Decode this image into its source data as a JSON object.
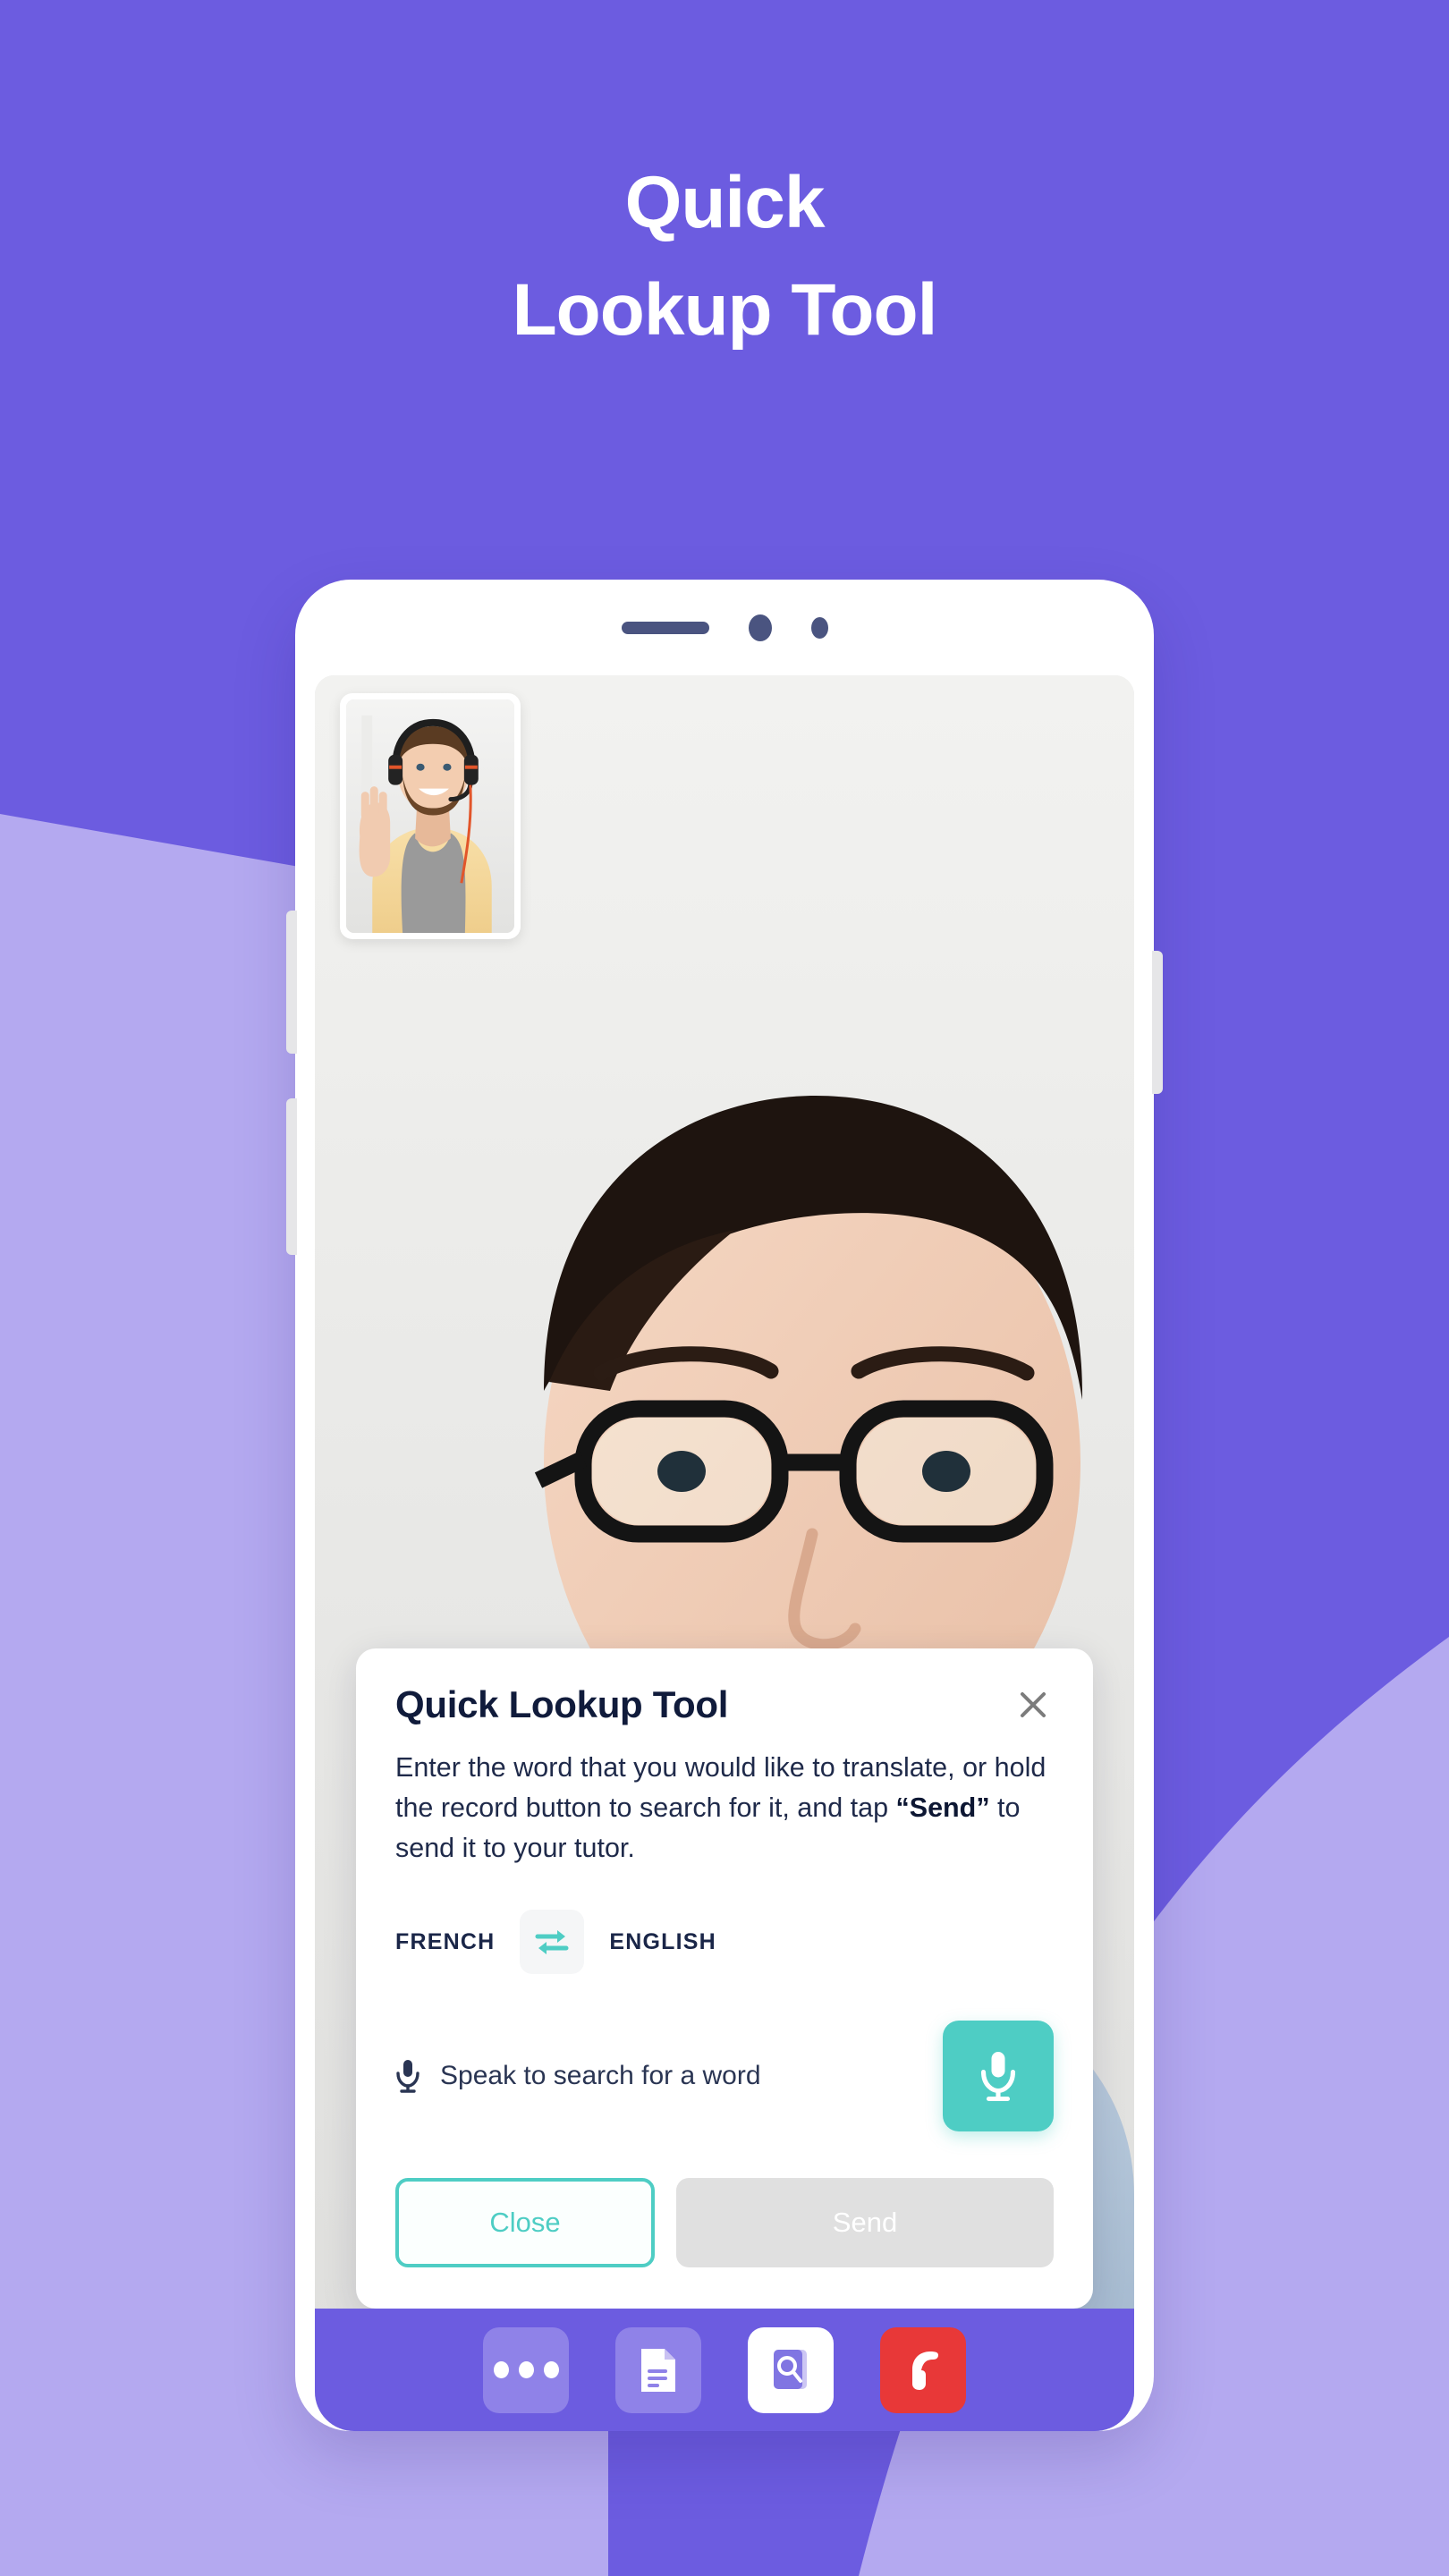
{
  "colors": {
    "background_purple": "#6C5CE0",
    "light_purple": "#B4A9F0",
    "teal_accent": "#4ECDC4",
    "end_call_red": "#E83838",
    "title_navy": "#101B3B",
    "disabled_grey": "#E0E0E0"
  },
  "headline": {
    "line1": "Quick",
    "line2": "Lookup Tool"
  },
  "phone": {
    "hardware": {
      "speaker_grille": "speaker-grille",
      "camera_primary": "front-camera",
      "camera_secondary": "sensor-dot",
      "volume_up": "volume-up-button",
      "volume_down": "volume-down-button",
      "power": "power-button"
    },
    "video_call": {
      "main_participant": "student-on-video",
      "pip_participant": "tutor-on-video"
    }
  },
  "dialog": {
    "title": "Quick Lookup Tool",
    "close_icon": "close-icon",
    "description_part1": "Enter the word that you would like to translate, or hold the record button to search for it, and tap ",
    "description_emphasis": "“Send”",
    "description_part2": " to send it to your tutor.",
    "language_from": "FRENCH",
    "language_to": "ENGLISH",
    "swap_icon": "swap-arrows-icon",
    "speak_placeholder": "Speak to search for a word",
    "speak_icon": "microphone-icon",
    "record_icon": "microphone-icon",
    "close_button": "Close",
    "send_button": "Send"
  },
  "toolbar": {
    "items": [
      {
        "name": "more-options",
        "icon": "ellipsis-icon",
        "label": "More"
      },
      {
        "name": "documents",
        "icon": "document-icon",
        "label": "Documents"
      },
      {
        "name": "dictionary",
        "icon": "dictionary-search-icon",
        "label": "Dictionary"
      },
      {
        "name": "end-call",
        "icon": "phone-icon",
        "label": "End call"
      }
    ]
  }
}
